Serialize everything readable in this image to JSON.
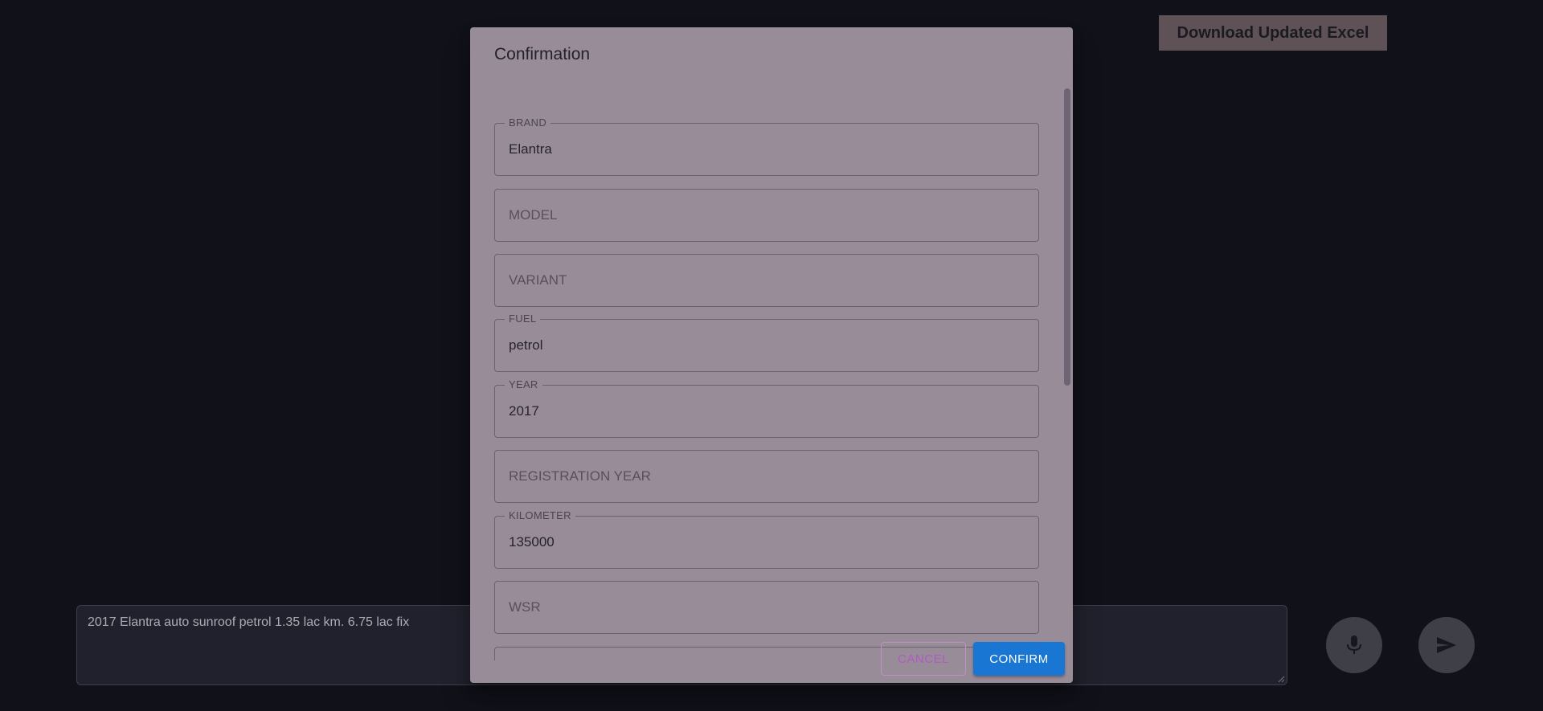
{
  "background": {
    "download_button_label": "Download Updated Excel",
    "composer_text": "2017 Elantra auto sunroof petrol 1.35 lac km. 6.75 lac fix",
    "mic_icon": "mic-icon",
    "send_icon": "send-icon"
  },
  "dialog": {
    "title": "Confirmation",
    "fields": [
      {
        "label": "BRAND",
        "value": "Elantra"
      },
      {
        "label": "MODEL",
        "value": ""
      },
      {
        "label": "VARIANT",
        "value": ""
      },
      {
        "label": "FUEL",
        "value": "petrol"
      },
      {
        "label": "YEAR",
        "value": "2017"
      },
      {
        "label": "REGISTRATION YEAR",
        "value": ""
      },
      {
        "label": "KILOMETER",
        "value": "135000"
      },
      {
        "label": "WSR",
        "value": ""
      },
      {
        "label": "",
        "value": ""
      }
    ],
    "cancel_label": "CANCEL",
    "confirm_label": "CONFIRM"
  },
  "colors": {
    "confirm_button": "#1976d2",
    "cancel_text": "#b259c4",
    "dialog_surface": "#998c99"
  }
}
